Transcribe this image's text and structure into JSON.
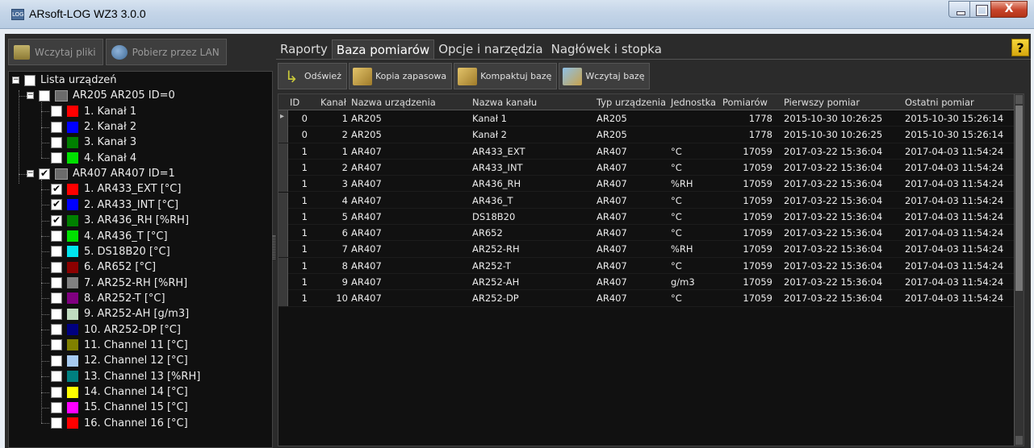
{
  "window": {
    "title": "ARsoft-LOG WZ3 3.0.0",
    "icon_text": "LOG",
    "close_glyph": "X"
  },
  "left_toolbar": {
    "load_files": "Wczytaj pliki",
    "download_lan": "Pobierz przez LAN"
  },
  "tree": {
    "root": "Lista urządzeń",
    "devices": [
      {
        "label": "AR205 AR205 ID=0",
        "checked": false,
        "channels": [
          {
            "label": "1. Kanał 1",
            "color": "#ff0000",
            "checked": false
          },
          {
            "label": "2. Kanał 2",
            "color": "#0000ff",
            "checked": false
          },
          {
            "label": "3. Kanał 3",
            "color": "#008000",
            "checked": false
          },
          {
            "label": "4. Kanał 4",
            "color": "#00e000",
            "checked": false
          }
        ]
      },
      {
        "label": "AR407 AR407 ID=1",
        "checked": true,
        "channels": [
          {
            "label": "1. AR433_EXT [°C]",
            "color": "#ff0000",
            "checked": true
          },
          {
            "label": "2. AR433_INT [°C]",
            "color": "#0000ff",
            "checked": true
          },
          {
            "label": "3. AR436_RH [%RH]",
            "color": "#008000",
            "checked": true
          },
          {
            "label": "4. AR436_T [°C]",
            "color": "#00e000",
            "checked": false
          },
          {
            "label": "5. DS18B20 [°C]",
            "color": "#00e5ee",
            "checked": false
          },
          {
            "label": "6. AR652 [°C]",
            "color": "#8b0000",
            "checked": false
          },
          {
            "label": "7. AR252-RH [%RH]",
            "color": "#808080",
            "checked": false
          },
          {
            "label": "8. AR252-T [°C]",
            "color": "#800080",
            "checked": false
          },
          {
            "label": "9. AR252-AH [g/m3]",
            "color": "#c0dcc0",
            "checked": false
          },
          {
            "label": "10. AR252-DP [°C]",
            "color": "#000080",
            "checked": false
          },
          {
            "label": "11. Channel 11 [°C]",
            "color": "#808000",
            "checked": false
          },
          {
            "label": "12. Channel 12 [°C]",
            "color": "#a6caf0",
            "checked": false
          },
          {
            "label": "13. Channel 13 [%RH]",
            "color": "#008080",
            "checked": false
          },
          {
            "label": "14. Channel 14 [°C]",
            "color": "#ffff00",
            "checked": false
          },
          {
            "label": "15. Channel 15 [°C]",
            "color": "#ff00ff",
            "checked": false
          },
          {
            "label": "16. Channel 16 [°C]",
            "color": "#ff0000",
            "checked": false
          }
        ]
      }
    ]
  },
  "tabs": [
    {
      "label": "Raporty",
      "active": false
    },
    {
      "label": "Baza pomiarów",
      "active": true
    },
    {
      "label": "Opcje i narzędzia",
      "active": false
    },
    {
      "label": "Nagłówek i stopka",
      "active": false
    }
  ],
  "help_label": "?",
  "toolbar": {
    "refresh": "Odśwież",
    "backup": "Kopia zapasowa",
    "compact": "Kompaktuj bazę",
    "load": "Wczytaj bazę"
  },
  "table": {
    "columns": [
      "ID",
      "Kanał",
      "Nazwa urządzenia",
      "Nazwa kanału",
      "Typ urządzenia",
      "Jednostka",
      "Pomiarów",
      "Pierwszy pomiar",
      "Ostatni pomiar"
    ],
    "rows": [
      [
        "0",
        "1",
        "AR205",
        "Kanał 1",
        "AR205",
        "",
        "1778",
        "2015-10-30 10:26:25",
        "2015-10-30 15:26:14"
      ],
      [
        "0",
        "2",
        "AR205",
        "Kanał 2",
        "AR205",
        "",
        "1778",
        "2015-10-30 10:26:25",
        "2015-10-30 15:26:14"
      ],
      [
        "1",
        "1",
        "AR407",
        "AR433_EXT",
        "AR407",
        "°C",
        "17059",
        "2017-03-22 15:36:04",
        "2017-04-03 11:54:24"
      ],
      [
        "1",
        "2",
        "AR407",
        "AR433_INT",
        "AR407",
        "°C",
        "17059",
        "2017-03-22 15:36:04",
        "2017-04-03 11:54:24"
      ],
      [
        "1",
        "3",
        "AR407",
        "AR436_RH",
        "AR407",
        "%RH",
        "17059",
        "2017-03-22 15:36:04",
        "2017-04-03 11:54:24"
      ],
      [
        "1",
        "4",
        "AR407",
        "AR436_T",
        "AR407",
        "°C",
        "17059",
        "2017-03-22 15:36:04",
        "2017-04-03 11:54:24"
      ],
      [
        "1",
        "5",
        "AR407",
        "DS18B20",
        "AR407",
        "°C",
        "17059",
        "2017-03-22 15:36:04",
        "2017-04-03 11:54:24"
      ],
      [
        "1",
        "6",
        "AR407",
        "AR652",
        "AR407",
        "°C",
        "17059",
        "2017-03-22 15:36:04",
        "2017-04-03 11:54:24"
      ],
      [
        "1",
        "7",
        "AR407",
        "AR252-RH",
        "AR407",
        "%RH",
        "17059",
        "2017-03-22 15:36:04",
        "2017-04-03 11:54:24"
      ],
      [
        "1",
        "8",
        "AR407",
        "AR252-T",
        "AR407",
        "°C",
        "17059",
        "2017-03-22 15:36:04",
        "2017-04-03 11:54:24"
      ],
      [
        "1",
        "9",
        "AR407",
        "AR252-AH",
        "AR407",
        "g/m3",
        "17059",
        "2017-03-22 15:36:04",
        "2017-04-03 11:54:24"
      ],
      [
        "1",
        "10",
        "AR407",
        "AR252-DP",
        "AR407",
        "°C",
        "17059",
        "2017-03-22 15:36:04",
        "2017-04-03 11:54:24"
      ]
    ]
  }
}
